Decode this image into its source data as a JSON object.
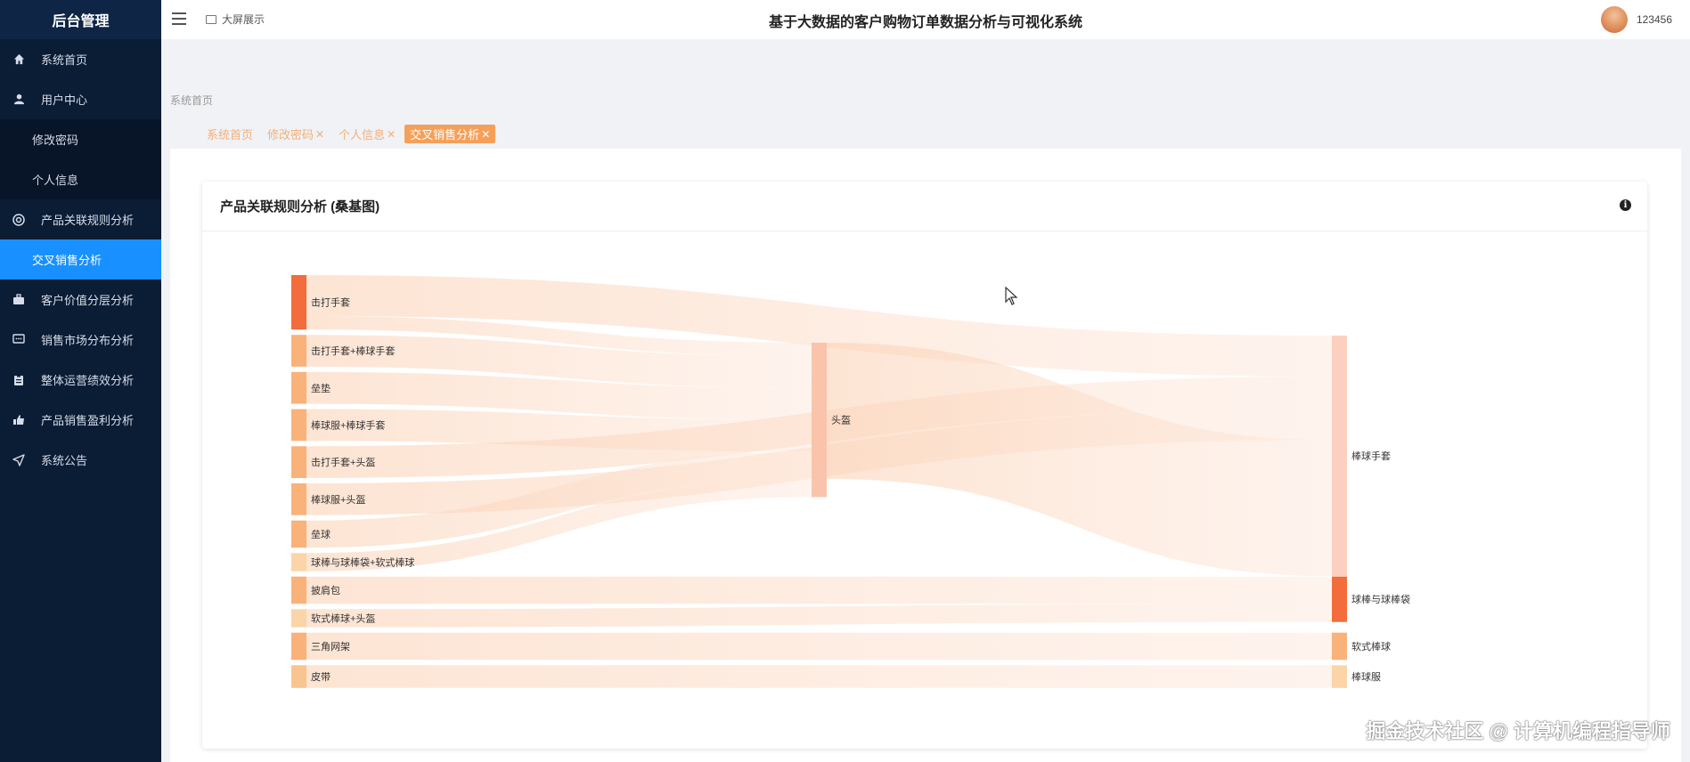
{
  "sidebar": {
    "brand": "后台管理",
    "items": [
      {
        "label": "系统首页",
        "icon": "home-icon"
      },
      {
        "label": "用户中心",
        "icon": "user-icon"
      },
      {
        "label": "修改密码",
        "sub": true
      },
      {
        "label": "个人信息",
        "sub": true
      },
      {
        "label": "产品关联规则分析",
        "icon": "lifebuoy-icon"
      },
      {
        "label": "交叉销售分析",
        "sub": true,
        "active": true
      },
      {
        "label": "客户价值分层分析",
        "icon": "briefcase-icon"
      },
      {
        "label": "销售市场分布分析",
        "icon": "message-icon"
      },
      {
        "label": "整体运营绩效分析",
        "icon": "clipboard-icon"
      },
      {
        "label": "产品销售盈利分析",
        "icon": "thumbs-up-icon"
      },
      {
        "label": "系统公告",
        "icon": "send-icon"
      }
    ]
  },
  "header": {
    "big_screen": "大屏展示",
    "title": "基于大数据的客户购物订单数据分析与可视化系统",
    "username": "123456"
  },
  "breadcrumb": "系统首页",
  "tabs": [
    {
      "label": "系统首页",
      "closable": false,
      "active": false
    },
    {
      "label": "修改密码",
      "closable": true,
      "active": false
    },
    {
      "label": "个人信息",
      "closable": true,
      "active": false
    },
    {
      "label": "交叉销售分析",
      "closable": true,
      "active": true
    }
  ],
  "card": {
    "title": "产品关联规则分析 (桑基图)"
  },
  "chart_data": {
    "type": "sankey",
    "title": "产品关联规则分析 (桑基图)",
    "nodes": [
      {
        "name": "击打手套",
        "column": 0,
        "color": "#f26c3c"
      },
      {
        "name": "击打手套+棒球手套",
        "column": 0,
        "color": "#f8b27a"
      },
      {
        "name": "垒垫",
        "column": 0,
        "color": "#f8b27a"
      },
      {
        "name": "棒球服+棒球手套",
        "column": 0,
        "color": "#f8b27a"
      },
      {
        "name": "击打手套+头盔",
        "column": 0,
        "color": "#f8b27a"
      },
      {
        "name": "棒球服+头盔",
        "column": 0,
        "color": "#f8b27a"
      },
      {
        "name": "垒球",
        "column": 0,
        "color": "#f8b27a"
      },
      {
        "name": "球棒与球棒袋+软式棒球",
        "column": 0,
        "color": "#fbd5a8"
      },
      {
        "name": "披肩包",
        "column": 0,
        "color": "#f8b27a"
      },
      {
        "name": "软式棒球+头盔",
        "column": 0,
        "color": "#fbd5a8"
      },
      {
        "name": "三角网架",
        "column": 0,
        "color": "#f8b27a"
      },
      {
        "name": "皮带",
        "column": 0,
        "color": "#f8c58f"
      },
      {
        "name": "头盔",
        "column": 1,
        "color": "#f9c4ab"
      },
      {
        "name": "棒球手套",
        "column": 2,
        "color": "#fbd0c0"
      },
      {
        "name": "球棒与球棒袋",
        "column": 2,
        "color": "#f26c3c"
      },
      {
        "name": "软式棒球",
        "column": 2,
        "color": "#f8b27a"
      },
      {
        "name": "棒球服",
        "column": 2,
        "color": "#fbd5a8"
      }
    ],
    "links": [
      {
        "source": "击打手套",
        "target": "棒球手套",
        "value": 4.5
      },
      {
        "source": "击打手套",
        "target": "头盔",
        "value": 1.5
      },
      {
        "source": "击打手套+棒球手套",
        "target": "头盔",
        "value": 3.5
      },
      {
        "source": "垒垫",
        "target": "头盔",
        "value": 3.5
      },
      {
        "source": "棒球服+棒球手套",
        "target": "头盔",
        "value": 3.5
      },
      {
        "source": "击打手套+头盔",
        "target": "棒球手套",
        "value": 3.5
      },
      {
        "source": "棒球服+头盔",
        "target": "棒球手套",
        "value": 3.5
      },
      {
        "source": "垒球",
        "target": "头盔",
        "value": 3
      },
      {
        "source": "球棒与球棒袋+软式棒球",
        "target": "头盔",
        "value": 2
      },
      {
        "source": "头盔",
        "target": "棒球手套",
        "value": 15
      },
      {
        "source": "披肩包",
        "target": "球棒与球棒袋",
        "value": 3
      },
      {
        "source": "软式棒球+头盔",
        "target": "球棒与球棒袋",
        "value": 2
      },
      {
        "source": "三角网架",
        "target": "软式棒球",
        "value": 3
      },
      {
        "source": "皮带",
        "target": "棒球服",
        "value": 2.5
      }
    ]
  },
  "watermark": "掘金技术社区 @ 计算机编程指导师",
  "colors": {
    "sidebar_bg": "#0b1c35",
    "active_menu": "#1890ff",
    "tab_active": "#f5a05a",
    "link": "#fbd9c0"
  }
}
